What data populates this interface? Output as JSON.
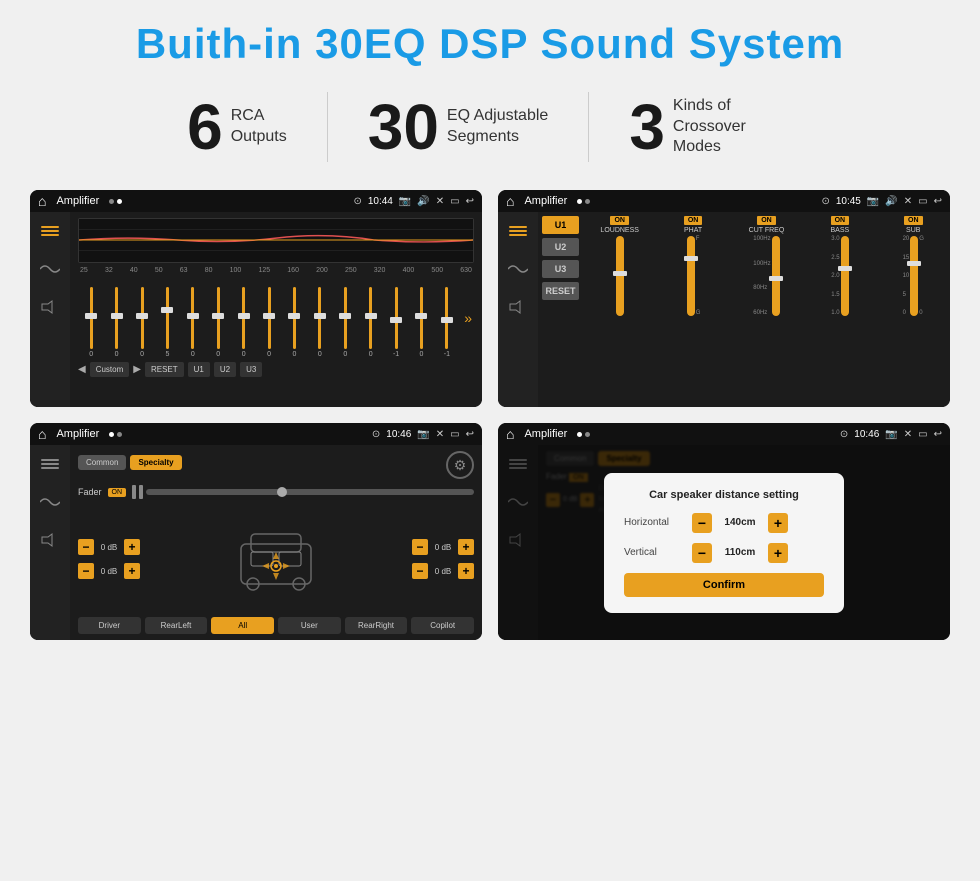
{
  "page": {
    "title": "Buith-in 30EQ DSP Sound System",
    "stats": [
      {
        "number": "6",
        "label": "RCA\nOutputs"
      },
      {
        "number": "30",
        "label": "EQ Adjustable\nSegments"
      },
      {
        "number": "3",
        "label": "Kinds of\nCrossover Modes"
      }
    ],
    "screens": [
      {
        "id": "screen1",
        "status_title": "Amplifier",
        "time": "10:44",
        "type": "equalizer"
      },
      {
        "id": "screen2",
        "status_title": "Amplifier",
        "time": "10:45",
        "type": "amplifier"
      },
      {
        "id": "screen3",
        "status_title": "Amplifier",
        "time": "10:46",
        "type": "fader"
      },
      {
        "id": "screen4",
        "status_title": "Amplifier",
        "time": "10:46",
        "type": "distance"
      }
    ],
    "eq": {
      "freqs": [
        "25",
        "32",
        "40",
        "50",
        "63",
        "80",
        "100",
        "125",
        "160",
        "200",
        "250",
        "320",
        "400",
        "500",
        "630"
      ],
      "values": [
        "0",
        "0",
        "0",
        "5",
        "0",
        "0",
        "0",
        "0",
        "0",
        "0",
        "0",
        "0",
        "-1",
        "0",
        "-1"
      ],
      "preset": "Custom",
      "buttons": [
        "RESET",
        "U1",
        "U2",
        "U3"
      ]
    },
    "amp": {
      "presets": [
        "U1",
        "U2",
        "U3"
      ],
      "controls": [
        "LOUDNESS",
        "PHAT",
        "CUT FREQ",
        "BASS",
        "SUB"
      ],
      "reset_label": "RESET"
    },
    "fader": {
      "tabs": [
        "Common",
        "Specialty"
      ],
      "active_tab": "Specialty",
      "fader_label": "Fader",
      "on_label": "ON",
      "db_values": [
        "0 dB",
        "0 dB",
        "0 dB",
        "0 dB"
      ],
      "bottom_buttons": [
        "Driver",
        "RearLeft",
        "All",
        "User",
        "RearRight",
        "Copilot"
      ]
    },
    "distance_dialog": {
      "title": "Car speaker distance setting",
      "horizontal_label": "Horizontal",
      "horizontal_value": "140cm",
      "vertical_label": "Vertical",
      "vertical_value": "110cm",
      "confirm_label": "Confirm"
    }
  }
}
